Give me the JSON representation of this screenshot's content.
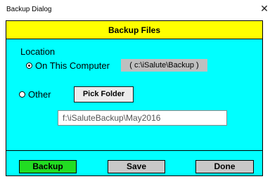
{
  "window": {
    "title": "Backup Dialog",
    "close_glyph": "✕"
  },
  "header": {
    "title": "Backup Files",
    "color": "#ffff00"
  },
  "panel_color": "#00ffff",
  "location": {
    "label": "Location",
    "options": [
      {
        "label": "On This Computer",
        "checked": true
      },
      {
        "label": "Other",
        "checked": false
      }
    ],
    "computer_path": "( c:\\iSalute\\Backup )",
    "pick_folder_label": "Pick Folder",
    "other_path_value": "f:\\iSaluteBackup\\May2016"
  },
  "buttons": {
    "backup": {
      "label": "Backup",
      "color": "#22dd22"
    },
    "save": {
      "label": "Save"
    },
    "done": {
      "label": "Done"
    }
  }
}
